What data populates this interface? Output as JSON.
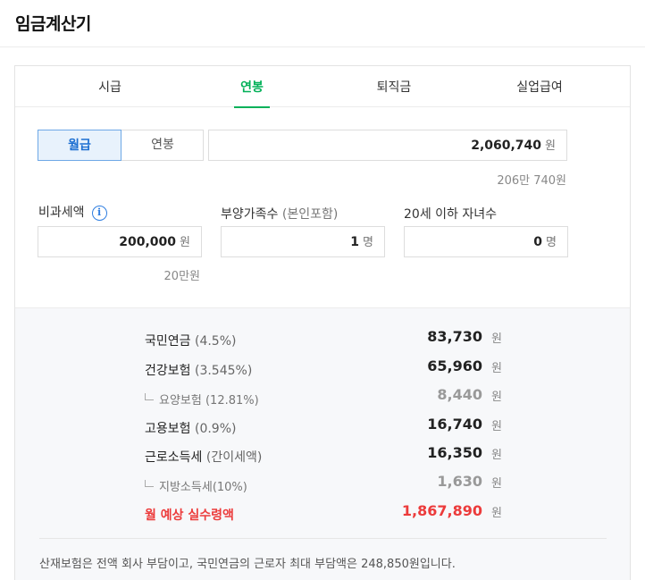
{
  "page": {
    "title": "임금계산기"
  },
  "tabs": [
    {
      "label": "시급"
    },
    {
      "label": "연봉"
    },
    {
      "label": "퇴직금"
    },
    {
      "label": "실업급여"
    }
  ],
  "salary": {
    "mode_monthly": "월급",
    "mode_annual": "연봉",
    "value": "2,060,740",
    "unit": "원",
    "helper": "206만 740원"
  },
  "nontax": {
    "label": "비과세액",
    "info_icon": "info-icon",
    "value": "200,000",
    "unit": "원",
    "helper": "20만원"
  },
  "dependents": {
    "label": "부양가족수",
    "label_sub": "(본인포함)",
    "value": "1",
    "unit": "명"
  },
  "children": {
    "label": "20세 이하 자녀수",
    "value": "0",
    "unit": "명"
  },
  "results": {
    "won": "원",
    "pension": {
      "label": "국민연금",
      "rate": "(4.5%)",
      "amount": "83,730"
    },
    "health": {
      "label": "건강보험",
      "rate": "(3.545%)",
      "amount": "65,960"
    },
    "care": {
      "label": "요양보험",
      "rate": "(12.81%)",
      "amount": "8,440"
    },
    "employment": {
      "label": "고용보험",
      "rate": "(0.9%)",
      "amount": "16,740"
    },
    "income_tax": {
      "label": "근로소득세",
      "rate": "(간이세액)",
      "amount": "16,350"
    },
    "local_tax": {
      "label": "지방소득세",
      "rate": "(10%)",
      "amount": "1,630"
    },
    "net": {
      "label": "월 예상 실수령액",
      "amount": "1,867,890"
    }
  },
  "note": "산재보험은 전액 회사 부담이고, 국민연금의 근로자 최대 부담액은 248,850원입니다.",
  "colors": {
    "accent_green": "#03b159",
    "accent_blue": "#1d6fd1",
    "accent_red": "#ec3b3b"
  }
}
